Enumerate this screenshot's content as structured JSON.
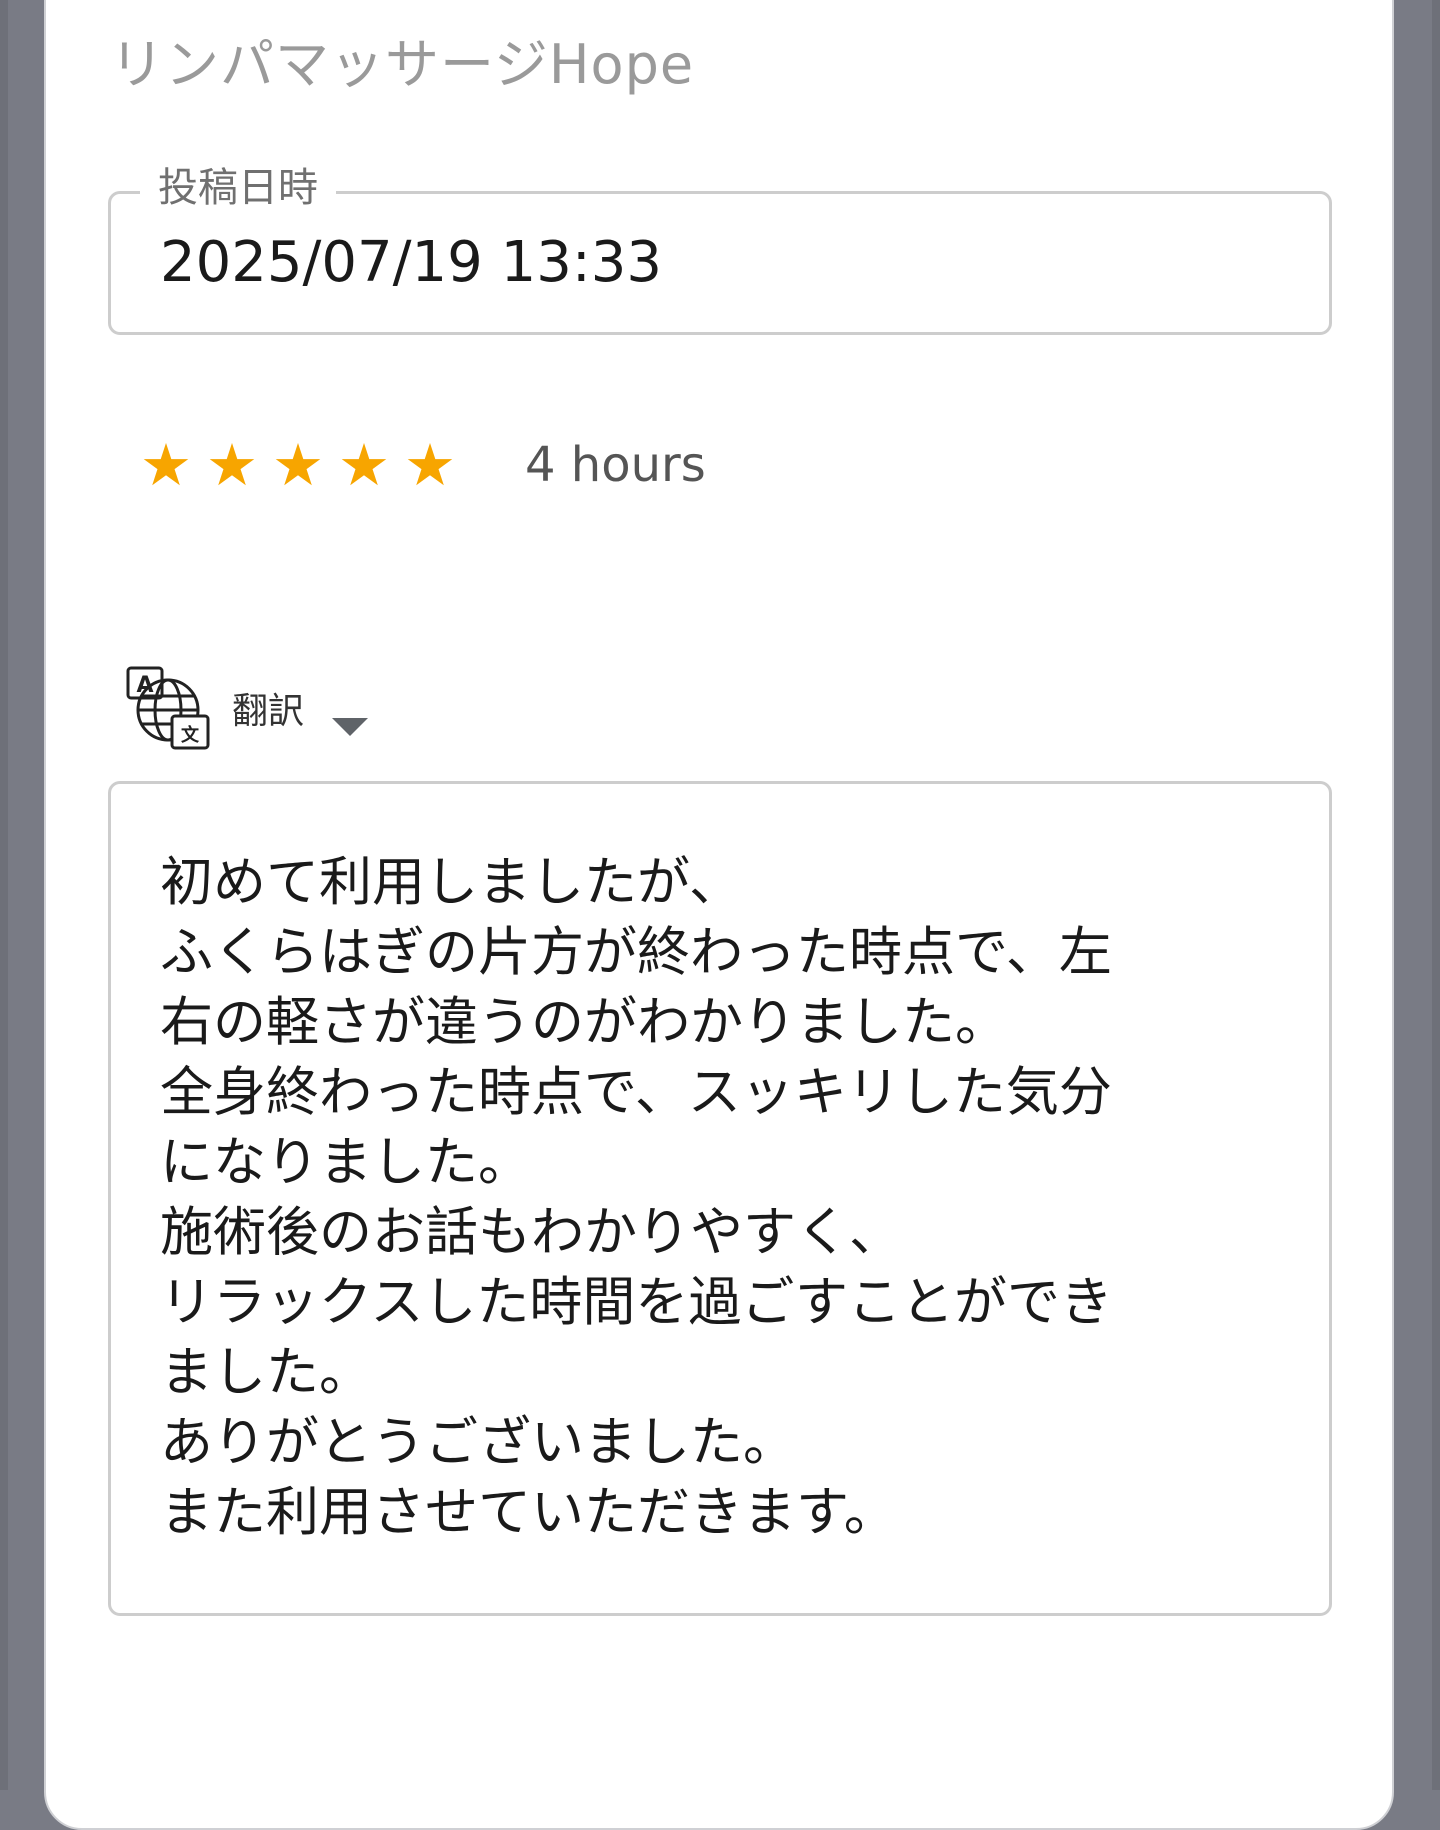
{
  "header": {
    "title": "リンパマッサージHope"
  },
  "post_date": {
    "label": "投稿日時",
    "value": "2025/07/19 13:33"
  },
  "rating": {
    "stars": 5,
    "max_stars": 5,
    "star_glyph": "★",
    "star_color": "#f7a500",
    "time_ago": "4 hours"
  },
  "translate": {
    "icon": "translate-icon",
    "label": "翻訳"
  },
  "review": {
    "lines": [
      "初めて利用しましたが、",
      "ふくらはぎの片方が終わった時点で、左",
      "右の軽さが違うのがわかりました。",
      "全身終わった時点で、スッキリした気分",
      "になりました。",
      "施術後のお話もわかりやすく、",
      "リラックスした時間を過ごすことができ",
      "ました。",
      "ありがとうございました。",
      "また利用させていただきます。"
    ]
  }
}
